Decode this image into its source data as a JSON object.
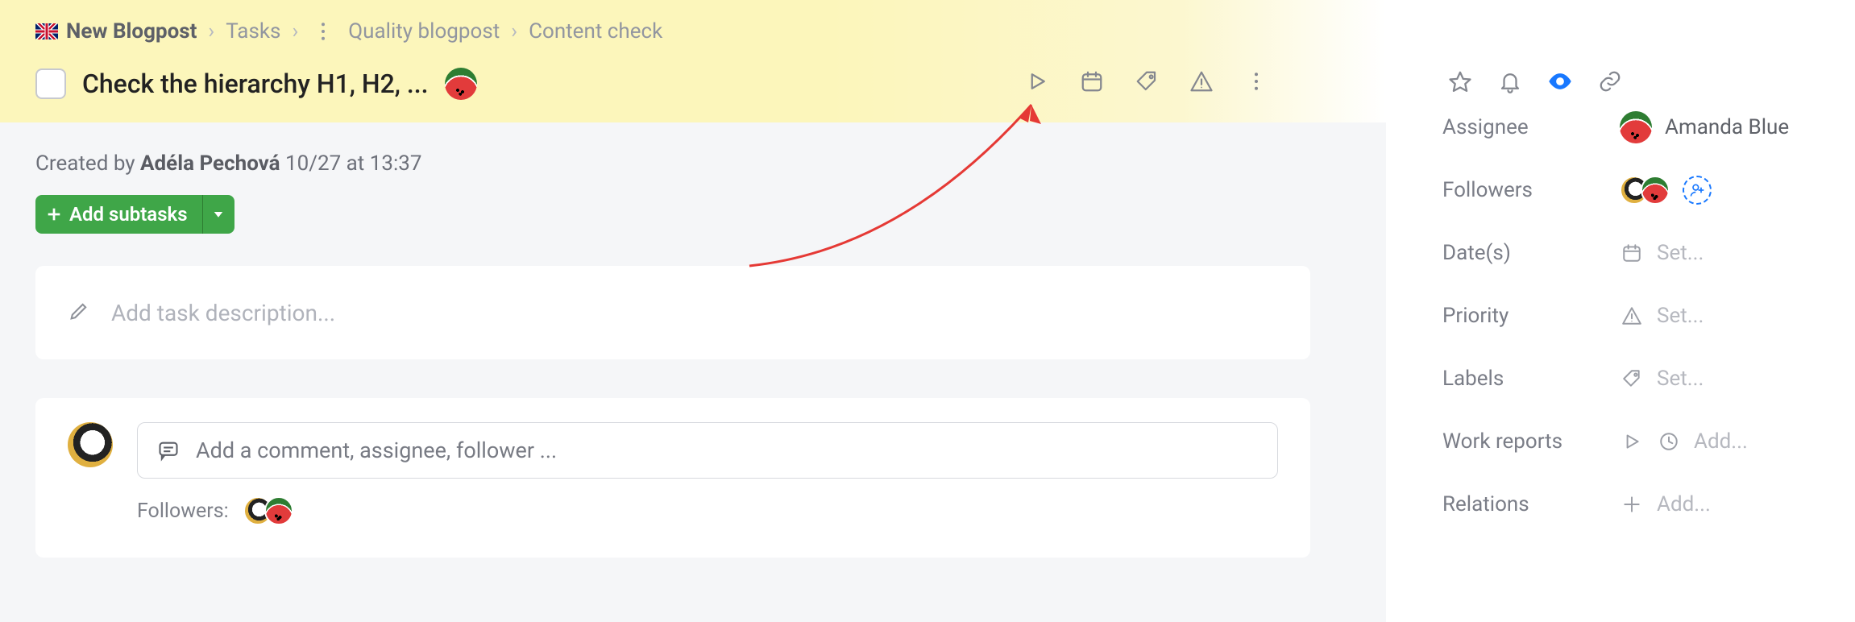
{
  "breadcrumb": {
    "root": "New Blogpost",
    "lvl1": "Tasks",
    "lvl2": "Quality blogpost",
    "lvl3": "Content check"
  },
  "task": {
    "title": "Check the hierarchy H1, H2, ...",
    "created_prefix": "Created by ",
    "created_by": "Adéla Pechová",
    "created_at": " 10/27 at 13:37"
  },
  "buttons": {
    "add_subtasks": "Add subtasks"
  },
  "description": {
    "placeholder": "Add task description..."
  },
  "comment": {
    "placeholder": "Add a comment, assignee, follower ...",
    "followers_label": "Followers:"
  },
  "sidebar": {
    "assignee_label": "Assignee",
    "assignee_value": "Amanda Blue",
    "followers_label": "Followers",
    "dates_label": "Date(s)",
    "dates_value": "Set...",
    "priority_label": "Priority",
    "priority_value": "Set...",
    "labels_label": "Labels",
    "labels_value": "Set...",
    "work_label": "Work reports",
    "work_value": "Add...",
    "relations_label": "Relations",
    "relations_value": "Add..."
  }
}
